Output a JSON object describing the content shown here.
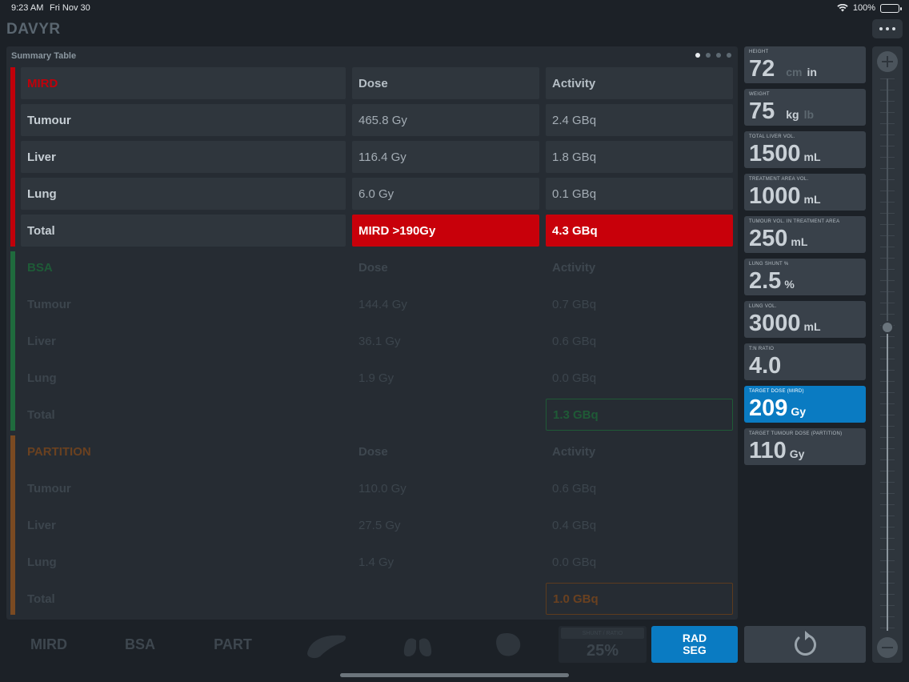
{
  "status_bar": {
    "time": "9:23 AM",
    "date": "Fri Nov 30",
    "battery": "100%"
  },
  "app": {
    "title": "DAVYR"
  },
  "summary": {
    "title": "Summary Table",
    "page_count": 4,
    "active_page": 0,
    "sections": [
      {
        "key": "mird",
        "name": "MIRD",
        "dose_header": "Dose",
        "activity_header": "Activity",
        "rows": [
          {
            "label": "Tumour",
            "dose": "465.8 Gy",
            "activity": "2.4 GBq"
          },
          {
            "label": "Liver",
            "dose": "116.4 Gy",
            "activity": "1.8 GBq"
          },
          {
            "label": "Lung",
            "dose": "6.0 Gy",
            "activity": "0.1 GBq"
          }
        ],
        "total": {
          "label": "Total",
          "dose": "MIRD >190Gy",
          "activity": "4.3 GBq"
        }
      },
      {
        "key": "bsa",
        "name": "BSA",
        "dose_header": "Dose",
        "activity_header": "Activity",
        "rows": [
          {
            "label": "Tumour",
            "dose": "144.4 Gy",
            "activity": "0.7 GBq"
          },
          {
            "label": "Liver",
            "dose": "36.1 Gy",
            "activity": "0.6 GBq"
          },
          {
            "label": "Lung",
            "dose": "1.9 Gy",
            "activity": "0.0 GBq"
          }
        ],
        "total": {
          "label": "Total",
          "dose": "",
          "activity": "1.3 GBq"
        }
      },
      {
        "key": "part",
        "name": "PARTITION",
        "dose_header": "Dose",
        "activity_header": "Activity",
        "rows": [
          {
            "label": "Tumour",
            "dose": "110.0 Gy",
            "activity": "0.6 GBq"
          },
          {
            "label": "Liver",
            "dose": "27.5 Gy",
            "activity": "0.4 GBq"
          },
          {
            "label": "Lung",
            "dose": "1.4 Gy",
            "activity": "0.0 GBq"
          }
        ],
        "total": {
          "label": "Total",
          "dose": "",
          "activity": "1.0 GBq"
        }
      }
    ]
  },
  "params": [
    {
      "name": "height",
      "label": "HEIGHT",
      "value": "72",
      "unit": "cm",
      "alt_unit": "in",
      "unit_active": "in"
    },
    {
      "name": "weight",
      "label": "WEIGHT",
      "value": "75",
      "unit": "kg",
      "alt_unit": "lb",
      "unit_active": "kg"
    },
    {
      "name": "total-liver-vol",
      "label": "TOTAL LIVER VOL.",
      "value": "1500",
      "unit": "mL"
    },
    {
      "name": "treatment-area-vol",
      "label": "TREATMENT AREA VOL.",
      "value": "1000",
      "unit": "mL"
    },
    {
      "name": "tumour-vol",
      "label": "TUMOUR VOL. IN TREATMENT AREA",
      "value": "250",
      "unit": "mL"
    },
    {
      "name": "lung-shunt",
      "label": "LUNG SHUNT %",
      "value": "2.5",
      "unit": "%"
    },
    {
      "name": "lung-vol",
      "label": "LUNG VOL.",
      "value": "3000",
      "unit": "mL"
    },
    {
      "name": "tn-ratio",
      "label": "T:N RATIO",
      "value": "4.0",
      "unit": ""
    },
    {
      "name": "target-dose-mird",
      "label": "TARGET DOSE (MIRD)",
      "value": "209",
      "unit": "Gy",
      "selected": true
    },
    {
      "name": "target-tumour-dose",
      "label": "TARGET TUMOUR DOSE (PARTITION)",
      "value": "110",
      "unit": "Gy"
    }
  ],
  "slider": {
    "level": 0.55
  },
  "toolbar": {
    "mird_label": "MIRD",
    "bsa_label": "BSA",
    "part_label": "PART",
    "share_label": "SHUNT / RATIO",
    "share_value": "25%",
    "rad_label": "RAD",
    "seg_label": "SEG"
  },
  "colors": {
    "mird": "#c0000a",
    "bsa": "#1f6b3d",
    "partition": "#7a4a22",
    "accent": "#0a7bc2"
  },
  "icons": [
    "wifi-icon",
    "battery-icon",
    "more-icon",
    "liver-icon",
    "lungs-icon",
    "organ-icon",
    "reset-icon",
    "plus-icon",
    "minus-icon"
  ]
}
